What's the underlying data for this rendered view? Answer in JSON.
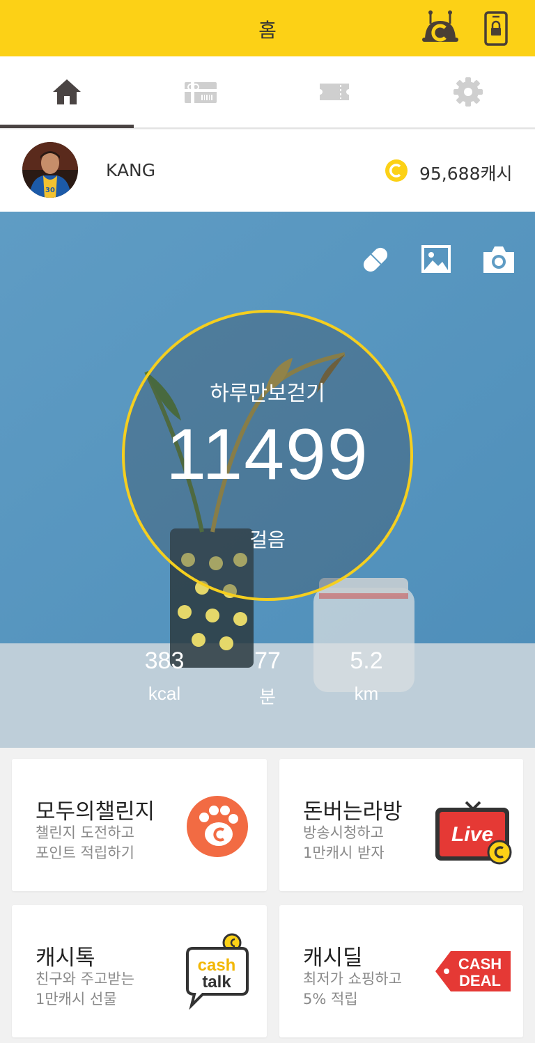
{
  "header": {
    "title": "홈",
    "icons": [
      "cash-bell-icon",
      "phone-lock-icon"
    ]
  },
  "tabs": [
    {
      "icon": "home-icon",
      "active": true
    },
    {
      "icon": "gift-icon",
      "active": false
    },
    {
      "icon": "ticket-icon",
      "active": false
    },
    {
      "icon": "gear-icon",
      "active": false
    }
  ],
  "profile": {
    "username": "KANG",
    "cash": "95,688캐시",
    "coin_icon": "c-coin-icon"
  },
  "hero": {
    "actions": [
      "pill-icon",
      "image-icon",
      "camera-icon"
    ],
    "ring_label": "하루만보걷기",
    "steps": "11499",
    "steps_unit": "걸음",
    "stats": [
      {
        "value": "383",
        "unit": "kcal"
      },
      {
        "value": "77",
        "unit": "분"
      },
      {
        "value": "5.2",
        "unit": "km"
      }
    ]
  },
  "cards": [
    {
      "title": "모두의챌린지",
      "subtitle": "챌린지 도전하고\n포인트 적립하기",
      "icon": "paw-coin-icon"
    },
    {
      "title": "돈버는라방",
      "subtitle": "방송시청하고\n1만캐시 받자",
      "icon": "live-tv-icon",
      "icon_text": "Live"
    },
    {
      "title": "캐시톡",
      "subtitle": "친구와 주고받는\n1만캐시 선물",
      "icon": "cashtalk-icon",
      "icon_text": [
        "cash",
        "talk"
      ]
    },
    {
      "title": "캐시딜",
      "subtitle": "최저가 쇼핑하고\n5% 적립",
      "icon": "cashdeal-tag-icon",
      "icon_text": [
        "CASH",
        "DEAL"
      ]
    }
  ],
  "colors": {
    "brand_yellow": "#fcd116",
    "ring": "#f5cf1f",
    "orange": "#f26b43",
    "red": "#e53935"
  }
}
